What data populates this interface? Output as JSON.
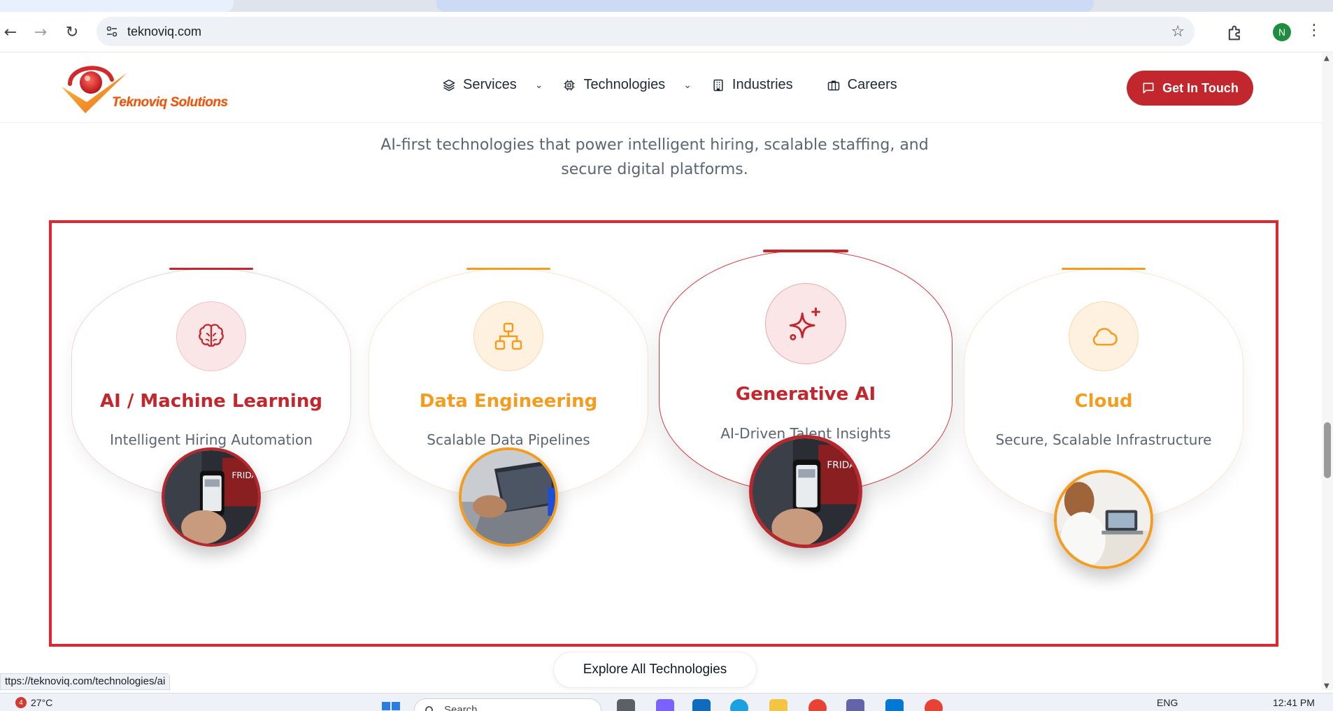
{
  "browser": {
    "url": "teknoviq.com",
    "profile_initial": "N",
    "status_url": "ttps://teknoviq.com/technologies/ai"
  },
  "site": {
    "logo_text": "Teknoviq Solutions",
    "nav": [
      {
        "label": "Services",
        "icon": "layers-icon",
        "dropdown": true
      },
      {
        "label": "Technologies",
        "icon": "chip-icon",
        "dropdown": true
      },
      {
        "label": "Industries",
        "icon": "building-icon",
        "dropdown": false
      },
      {
        "label": "Careers",
        "icon": "briefcase-icon",
        "dropdown": false
      }
    ],
    "cta_label": "Get In Touch"
  },
  "intro": "AI-first technologies that power intelligent hiring, scalable staffing, and secure digital platforms.",
  "cards": [
    {
      "title": "AI / Machine Learning",
      "subtitle": "Intelligent Hiring Automation",
      "icon": "brain-icon",
      "accent": "#c1272d"
    },
    {
      "title": "Data Engineering",
      "subtitle": "Scalable Data Pipelines",
      "icon": "network-icon",
      "accent": "#f39c1f"
    },
    {
      "title": "Generative AI",
      "subtitle": "AI-Driven Talent Insights",
      "icon": "sparkles-icon",
      "accent": "#c1272d"
    },
    {
      "title": "Cloud",
      "subtitle": "Secure, Scalable Infrastructure",
      "icon": "cloud-icon",
      "accent": "#f39c1f"
    }
  ],
  "explore_label": "Explore All Technologies",
  "taskbar": {
    "weather": "27°C",
    "weather_badge": "4",
    "search_placeholder": "Search",
    "language": "ENG",
    "time": "12:41 PM"
  },
  "colors": {
    "brand_red": "#c1272d",
    "brand_orange": "#f39c1f",
    "highlight_frame": "#e3262e"
  }
}
